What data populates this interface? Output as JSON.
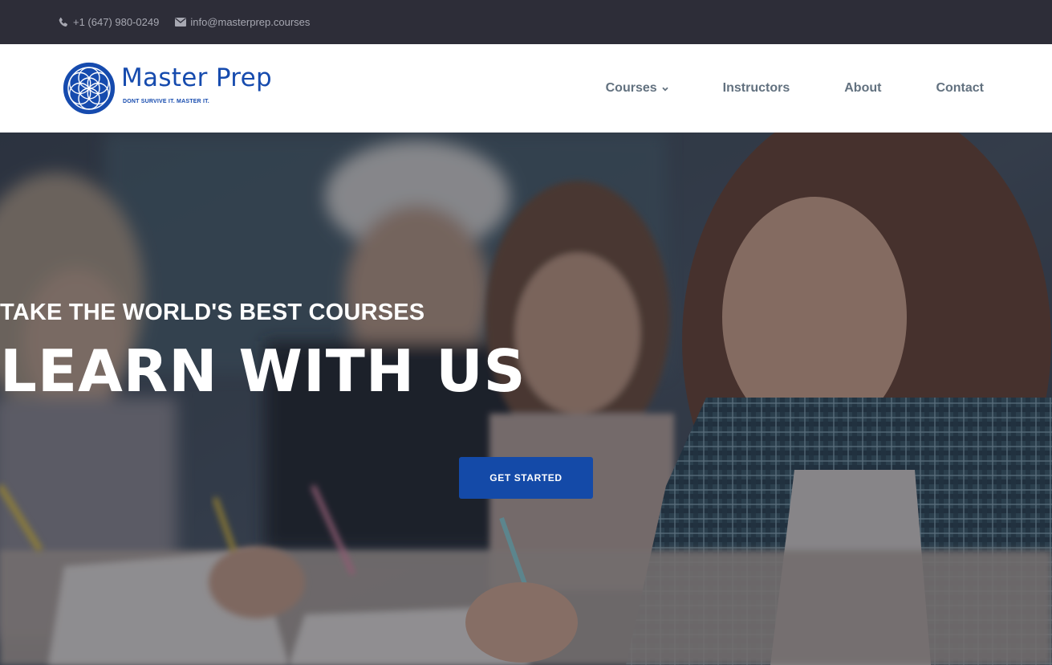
{
  "topbar": {
    "phone": "+1 (647) 980-0249",
    "email": "info@masterprep.courses",
    "phone_icon": "phone-icon",
    "email_icon": "envelope-icon"
  },
  "brand": {
    "name": "Master Prep",
    "tagline": "DONT SURVIVE IT. MASTER IT.",
    "logo_icon": "flower-of-life-logo",
    "color": "#164bae"
  },
  "nav": {
    "items": [
      {
        "label": "Courses",
        "has_dropdown": true
      },
      {
        "label": "Instructors"
      },
      {
        "label": "About"
      },
      {
        "label": "Contact"
      }
    ],
    "text_color": "#62717f"
  },
  "hero": {
    "subtitle": "TAKE THE WORLD'S BEST COURSES",
    "title": "LEARN WITH US",
    "cta_label": "GET STARTED",
    "cta_color": "#144aa8",
    "background": "photo of students writing at desks"
  }
}
